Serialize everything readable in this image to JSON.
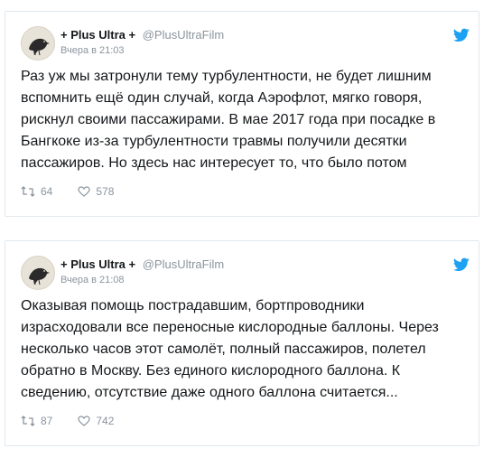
{
  "tweets": [
    {
      "display_name": "+ Plus Ultra +",
      "handle": "@PlusUltraFilm",
      "timestamp": "Вчера в 21:03",
      "text_lines": [
        "Раз уж мы затронули тему турбулентности, не будет лишним",
        "вспомнить ещё один случай, когда Аэрофлот, мягко говоря,",
        "рискнул своими пассажирами. В мае 2017 года при посадке в",
        "Бангкоке из-за турбулентности травмы получили десятки",
        "пассажиров. Но здесь нас интересует то, что было потом"
      ],
      "retweets": "64",
      "likes": "578"
    },
    {
      "display_name": "+ Plus Ultra +",
      "handle": "@PlusUltraFilm",
      "timestamp": "Вчера в 21:08",
      "text_lines": [
        "Оказывая помощь пострадавшим, бортпроводники",
        "израсходовали все переносные кислородные баллоны. Через",
        "несколько часов этот самолёт, полный пассажиров, полетел",
        "обратно в Москву. Без единого кислородного баллона. К",
        "сведению, отсутствие даже одного баллона считается..."
      ],
      "retweets": "87",
      "likes": "742"
    }
  ],
  "icons": {
    "twitter": "twitter-bird-icon",
    "retweet": "retweet-icon",
    "like": "heart-icon",
    "avatar": "crow-avatar"
  },
  "colors": {
    "twitter_blue": "#1da1f2",
    "text": "#14171a",
    "muted": "#8a959e",
    "border": "#e1e8ed"
  }
}
